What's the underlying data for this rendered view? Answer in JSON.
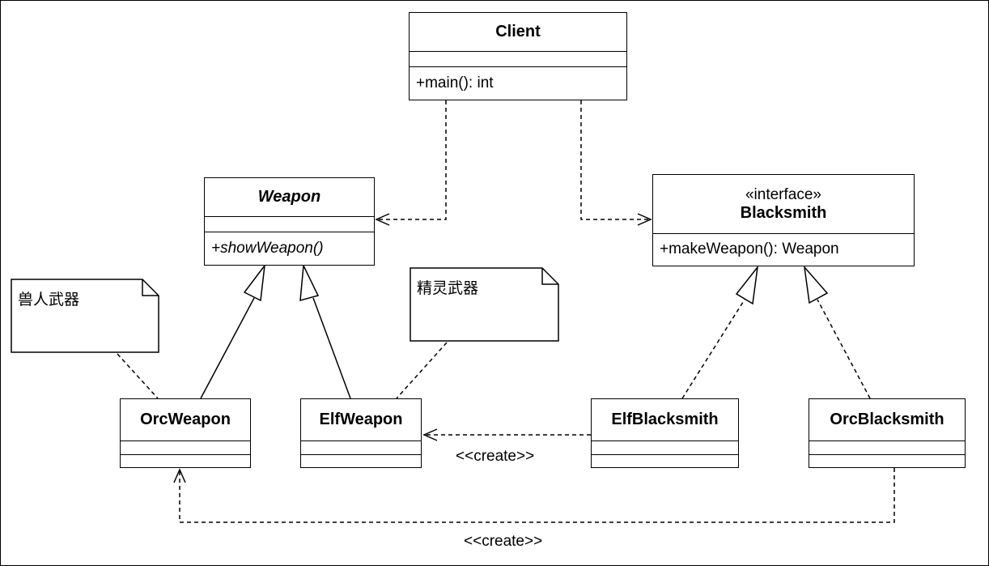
{
  "classes": {
    "client": {
      "name": "Client",
      "op": "+main(): int"
    },
    "weapon": {
      "name": "Weapon",
      "op": "+showWeapon()"
    },
    "blacksmith": {
      "stereotype": "«interface»",
      "name": "Blacksmith",
      "op": "+makeWeapon(): Weapon"
    },
    "orc_weapon": {
      "name": "OrcWeapon"
    },
    "elf_weapon": {
      "name": "ElfWeapon"
    },
    "elf_blacksmith": {
      "name": "ElfBlacksmith"
    },
    "orc_blacksmith": {
      "name": "OrcBlacksmith"
    }
  },
  "notes": {
    "orc_note": "兽人武器",
    "elf_note": "精灵武器"
  },
  "relations": {
    "elf_create_label": "<<create>>",
    "orc_create_label": "<<create>>"
  }
}
